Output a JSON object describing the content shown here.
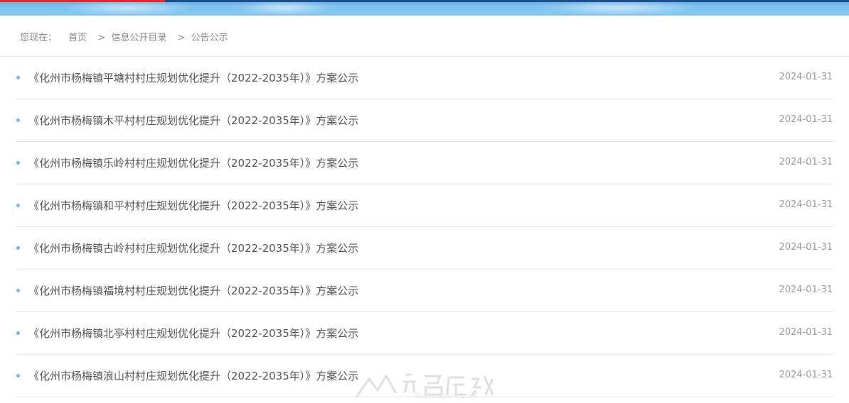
{
  "breadcrumb": {
    "prefix": "您现在：",
    "items": [
      {
        "label": "首页"
      },
      {
        "sep": ">",
        "label": "信息公开目录"
      },
      {
        "sep": ">",
        "label": "公告公示"
      }
    ]
  },
  "announcements": [
    {
      "title": "《化州市杨梅镇平塘村村庄规划优化提升（2022-2035年）》方案公示",
      "date": "2024-01-31"
    },
    {
      "title": "《化州市杨梅镇木平村村庄规划优化提升（2022-2035年）》方案公示",
      "date": "2024-01-31"
    },
    {
      "title": "《化州市杨梅镇乐岭村村庄规划优化提升（2022-2035年）》方案公示",
      "date": "2024-01-31"
    },
    {
      "title": "《化州市杨梅镇和平村村庄规划优化提升（2022-2035年）》方案公示",
      "date": "2024-01-31"
    },
    {
      "title": "《化州市杨梅镇古岭村村庄规划优化提升（2022-2035年）》方案公示",
      "date": "2024-01-31"
    },
    {
      "title": "《化州市杨梅镇福境村村庄规划优化提升（2022-2035年）》方案公示",
      "date": "2024-01-31"
    },
    {
      "title": "《化州市杨梅镇北亭村村庄规划优化提升（2022-2035年）》方案公示",
      "date": "2024-01-31"
    },
    {
      "title": "《化州市杨梅镇浪山村村庄规划优化提升（2022-2035年）》方案公示",
      "date": "2024-01-31"
    }
  ],
  "watermark": {
    "text": "WWW.GDMM.COM"
  },
  "colors": {
    "banner": "#86c8f2",
    "accent_red": "#e02b2b",
    "bullet": "#6fb7e8",
    "title_text": "#555555",
    "date_text": "#9a9a9a"
  }
}
